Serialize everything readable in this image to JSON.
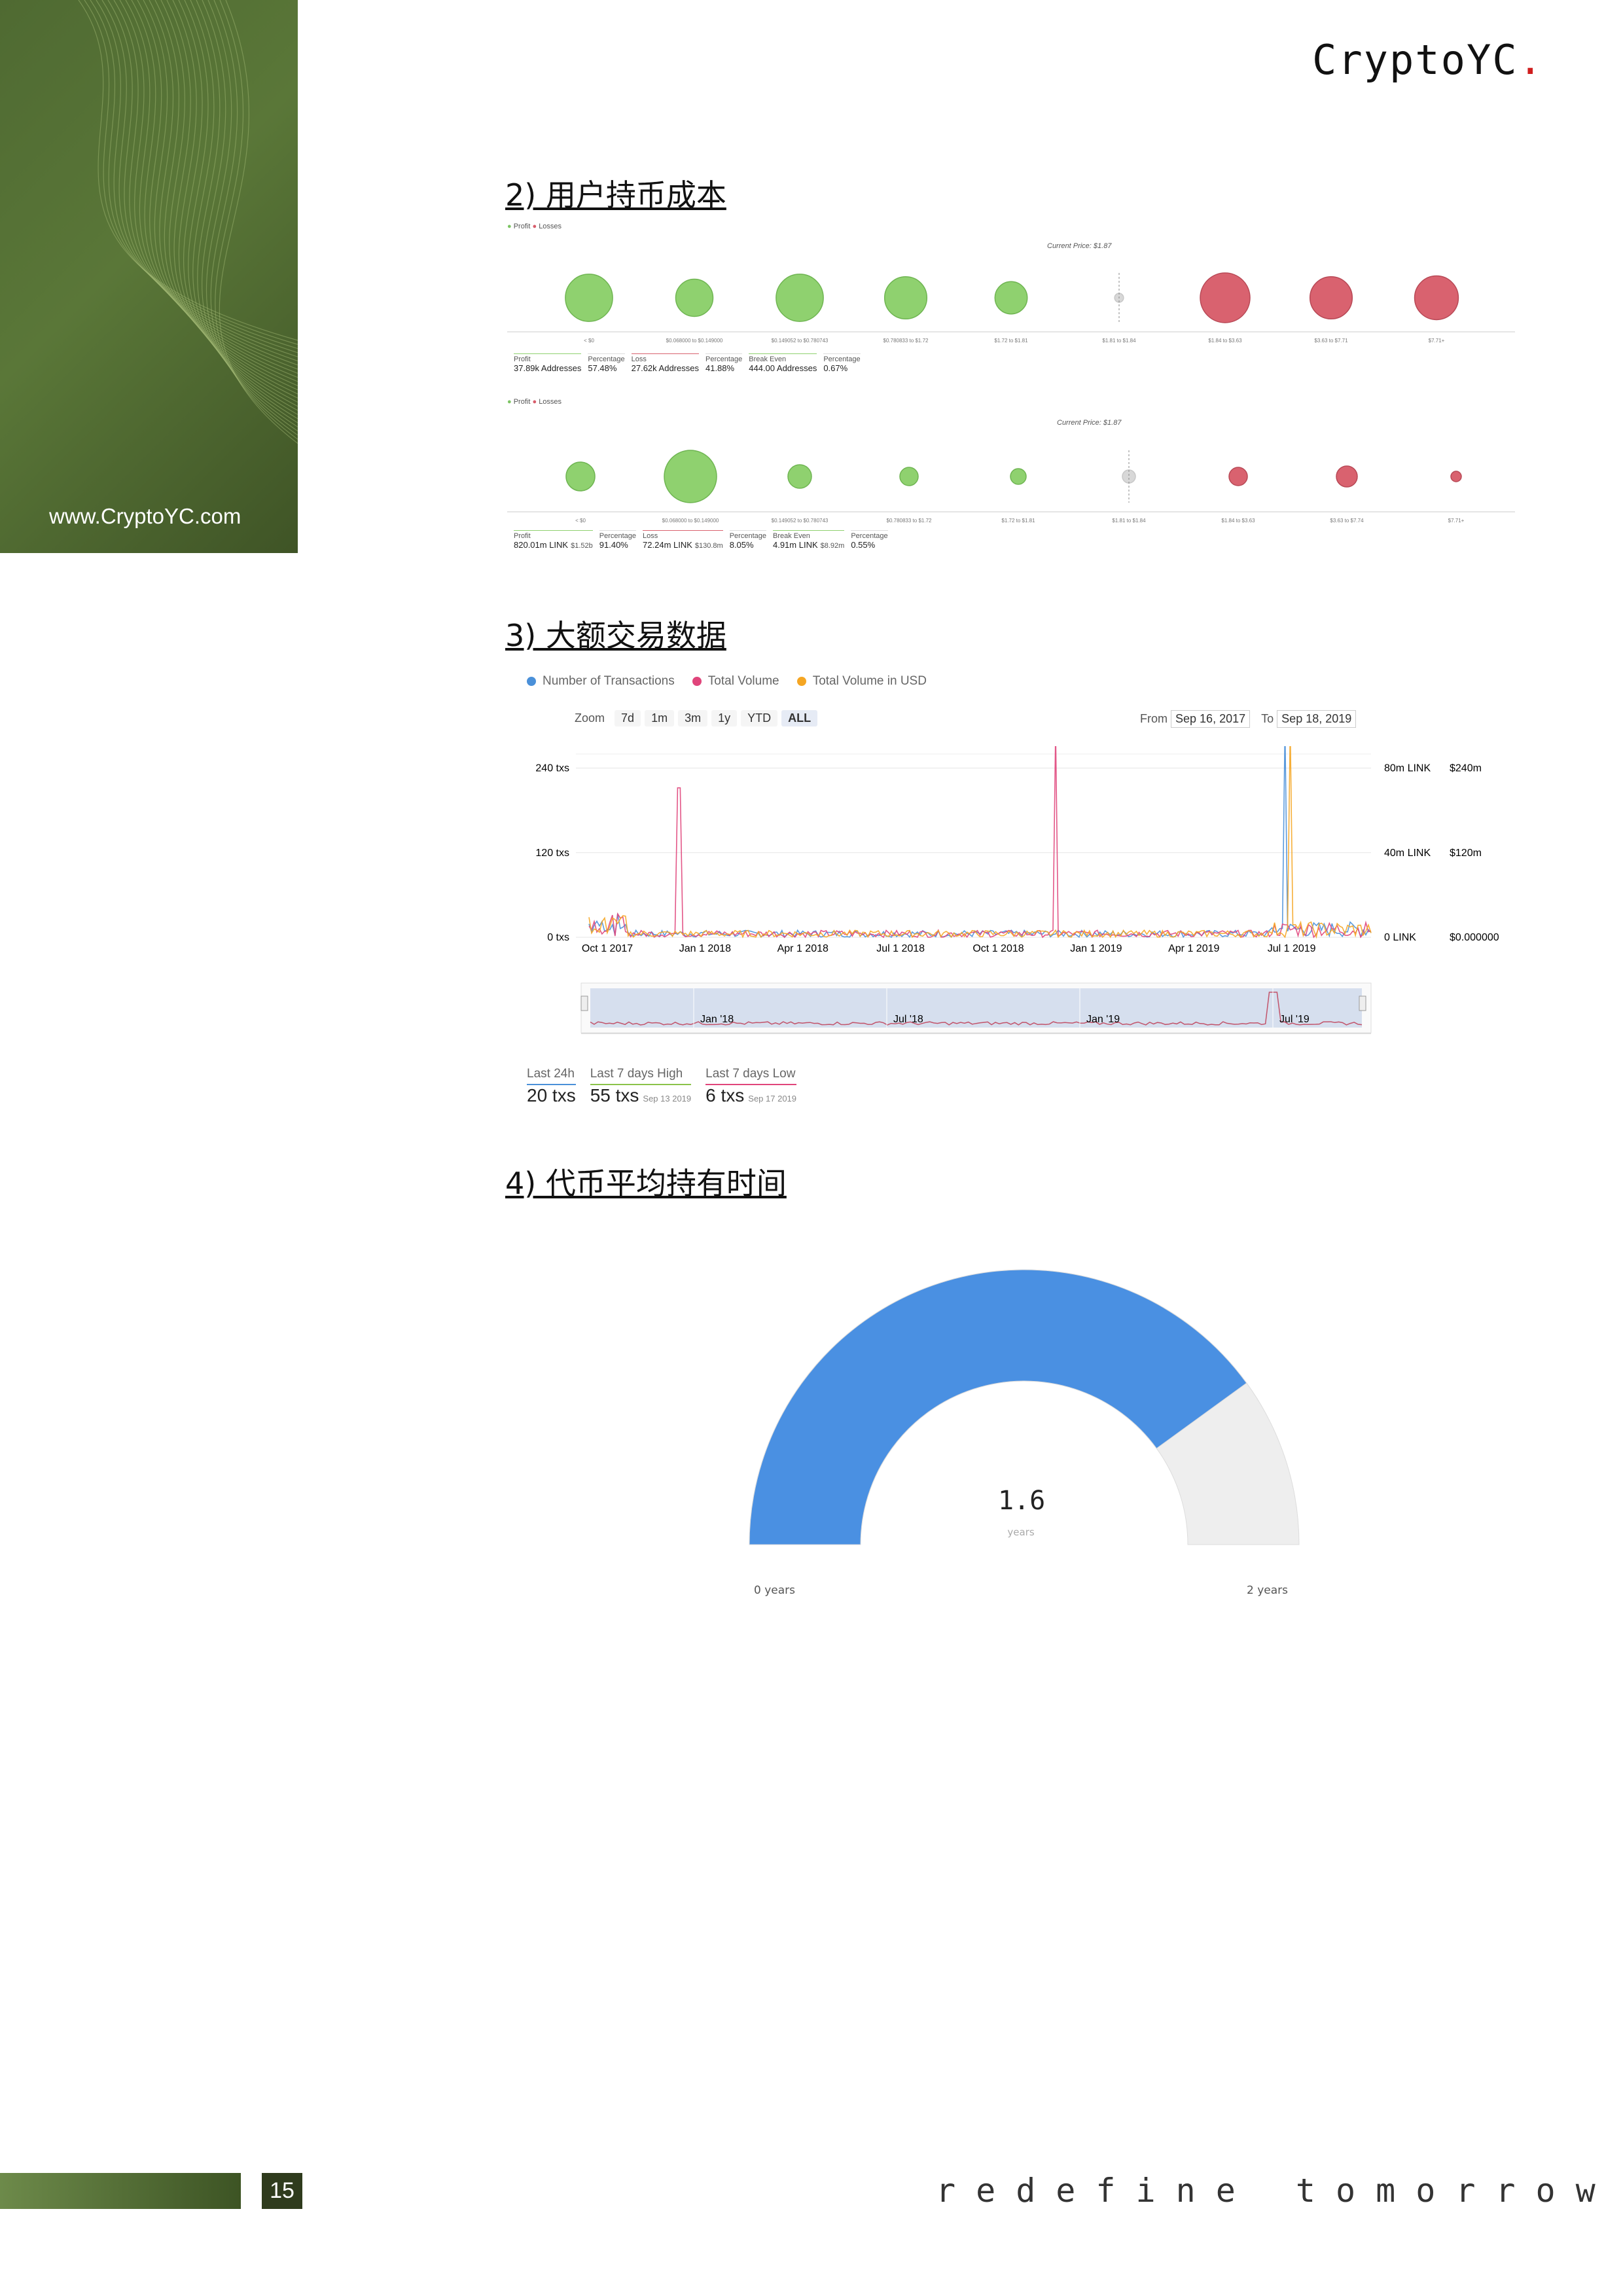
{
  "brand": {
    "logo_text": "CryptoYC",
    "logo_dot": ".",
    "site_url": "www.CryptoYC.com",
    "accent_color": "#d01e1e",
    "green": "#56723a"
  },
  "sections": {
    "s2_title": "2) 用户持币成本",
    "s3_title": "3) 大额交易数据",
    "s4_title": "4) 代币平均持有时间"
  },
  "bubble_chart_1": {
    "legend": [
      "Profit",
      "Losses"
    ],
    "current_price": "Current Price: $1.87",
    "bubbles": [
      {
        "label": "< $0",
        "status": "profit",
        "size": 0.95
      },
      {
        "label": "$0.068000 to $0.149000",
        "status": "profit",
        "size": 0.75
      },
      {
        "label": "$0.149052 to $0.780743",
        "status": "profit",
        "size": 0.95
      },
      {
        "label": "$0.780833 to $1.72",
        "status": "profit",
        "size": 0.85
      },
      {
        "label": "$1.72 to $1.81",
        "status": "profit",
        "size": 0.65
      },
      {
        "label": "$1.81 to $1.84",
        "status": "neutral",
        "size": 0.18
      },
      {
        "label": "$1.84 to $3.63",
        "status": "loss",
        "size": 1.0
      },
      {
        "label": "$3.63 to $7.71",
        "status": "loss",
        "size": 0.85
      },
      {
        "label": "$7.71+",
        "status": "loss",
        "size": 0.88
      }
    ],
    "stats": [
      {
        "k": "Profit",
        "v": "37.89k Addresses"
      },
      {
        "k": "Percentage",
        "v": "57.48%"
      },
      {
        "k": "Loss",
        "v": "27.62k Addresses"
      },
      {
        "k": "Percentage",
        "v": "41.88%"
      },
      {
        "k": "Break Even",
        "v": "444.00 Addresses"
      },
      {
        "k": "Percentage",
        "v": "0.67%"
      }
    ]
  },
  "bubble_chart_2": {
    "legend": [
      "Profit",
      "Losses"
    ],
    "current_price": "Current Price: $1.87",
    "bubbles": [
      {
        "label": "< $0",
        "status": "profit",
        "size": 0.55
      },
      {
        "label": "$0.068000 to $0.149000",
        "status": "profit",
        "size": 1.0
      },
      {
        "label": "$0.149052 to $0.780743",
        "status": "profit",
        "size": 0.45
      },
      {
        "label": "$0.780833 to $1.72",
        "status": "profit",
        "size": 0.35
      },
      {
        "label": "$1.72 to $1.81",
        "status": "profit",
        "size": 0.3
      },
      {
        "label": "$1.81 to $1.84",
        "status": "neutral",
        "size": 0.25
      },
      {
        "label": "$1.84 to $3.63",
        "status": "loss",
        "size": 0.35
      },
      {
        "label": "$3.63 to $7.74",
        "status": "loss",
        "size": 0.4
      },
      {
        "label": "$7.71+",
        "status": "loss",
        "size": 0.2
      }
    ],
    "stats": [
      {
        "k": "Profit",
        "v": "820.01m LINK",
        "x": "$1.52b"
      },
      {
        "k": "Percentage",
        "v": "91.40%",
        "x": ""
      },
      {
        "k": "Loss",
        "v": "72.24m LINK",
        "x": "$130.8m"
      },
      {
        "k": "Percentage",
        "v": "8.05%",
        "x": ""
      },
      {
        "k": "Break Even",
        "v": "4.91m LINK",
        "x": "$8.92m"
      },
      {
        "k": "Percentage",
        "v": "0.55%",
        "x": ""
      }
    ]
  },
  "chart_data": {
    "type": "line",
    "legend": [
      {
        "name": "Number of Transactions",
        "color": "#4a90d9"
      },
      {
        "name": "Total Volume",
        "color": "#e0457b"
      },
      {
        "name": "Total Volume in USD",
        "color": "#f5a623"
      }
    ],
    "zoom_label": "Zoom",
    "zoom_options": [
      "7d",
      "1m",
      "3m",
      "1y",
      "YTD",
      "ALL"
    ],
    "zoom_active": "ALL",
    "from_label": "From",
    "from_date": "Sep 16, 2017",
    "to_label": "To",
    "to_date": "Sep 18, 2019",
    "y_left_ticks": [
      "240 txs",
      "120 txs",
      "0 txs"
    ],
    "y_right_ticks_1": [
      "80m LINK",
      "40m LINK",
      "0 LINK"
    ],
    "y_right_ticks_2": [
      "$240m",
      "$120m",
      "$0.000000"
    ],
    "x_ticks": [
      "Oct 1 2017",
      "Jan 1 2018",
      "Apr 1 2018",
      "Jul 1 2018",
      "Oct 1 2018",
      "Jan 1 2019",
      "Apr 1 2019",
      "Jul 1 2019"
    ],
    "navigator_ticks": [
      "Jan '18",
      "Jul '18",
      "Jan '19",
      "Jul '19"
    ],
    "ylim": [
      0,
      260
    ],
    "spikes": [
      {
        "x": 0.115,
        "series": "Total Volume",
        "value": 212
      },
      {
        "x": 0.597,
        "series": "Total Volume",
        "value": 295
      },
      {
        "x": 0.889,
        "series": "Number of Transactions",
        "value": 320
      },
      {
        "x": 0.898,
        "series": "Total Volume in USD",
        "value": 300
      }
    ],
    "stats": [
      {
        "label": "Last 24h",
        "value": "20 txs",
        "date": "",
        "color": "#4a90d9"
      },
      {
        "label": "Last 7 days High",
        "value": "55 txs",
        "date": "Sep 13 2019",
        "color": "#8bc34a"
      },
      {
        "label": "Last 7 days Low",
        "value": "6 txs",
        "date": "Sep 17 2019",
        "color": "#e0457b"
      }
    ]
  },
  "gauge": {
    "value": 1.6,
    "value_text": "1.6",
    "unit": "years",
    "min_label": "0 years",
    "max_label": "2 years",
    "min": 0,
    "max": 2,
    "fill_color": "#4a90e2",
    "track_color": "#eeeeee"
  },
  "footer": {
    "page_number": "15",
    "tagline": "redefine tomorrow"
  }
}
